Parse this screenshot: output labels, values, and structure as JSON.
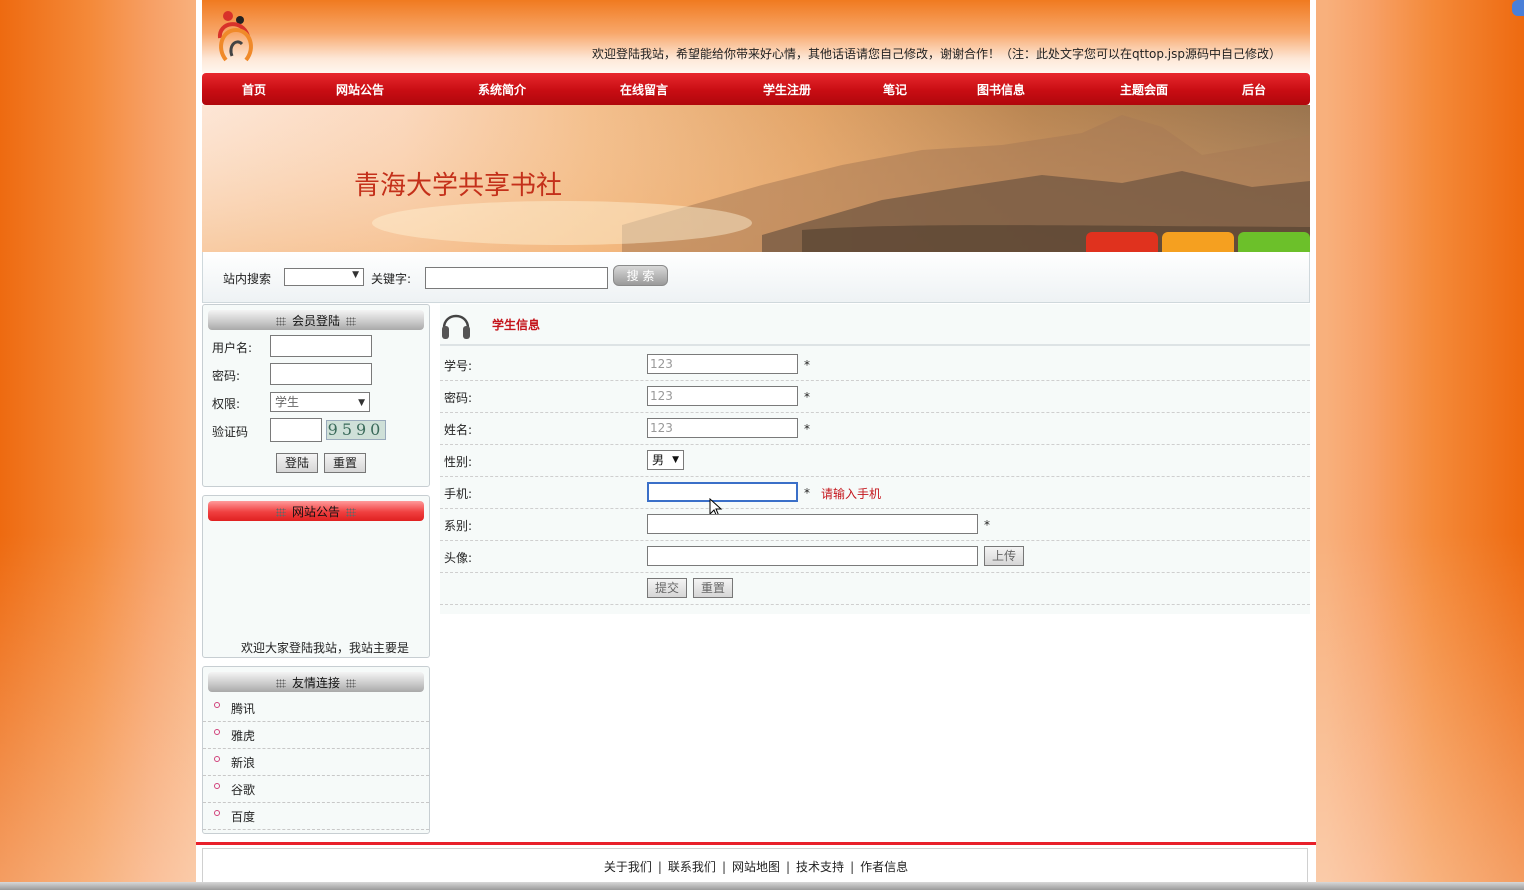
{
  "header": {
    "welcome_text": "欢迎登陆我站，希望能给你带来好心情，其他话语请您自己修改，谢谢合作！（注：此处文字您可以在qttop.jsp源码中自己修改）"
  },
  "nav": {
    "items": [
      {
        "label": "首页"
      },
      {
        "label": "网站公告"
      },
      {
        "label": "系统简介"
      },
      {
        "label": "在线留言"
      },
      {
        "label": "学生注册"
      },
      {
        "label": "笔记"
      },
      {
        "label": "图书信息"
      },
      {
        "label": "主题会面"
      },
      {
        "label": "后台"
      }
    ]
  },
  "banner": {
    "title": "青海大学共享书社"
  },
  "search": {
    "label": "站内搜索",
    "select_value": "",
    "keyword_label": "关键字:",
    "keyword_value": "",
    "button_label": "搜 索"
  },
  "login_box": {
    "title": "会员登陆",
    "username_label": "用户名:",
    "password_label": "密码:",
    "role_label": "权限:",
    "role_value": "学生",
    "captcha_label": "验证码",
    "captcha_code": "9590",
    "login_button": "登陆",
    "reset_button": "重置"
  },
  "notice_box": {
    "title": "网站公告",
    "text": "欢迎大家登陆我站，我站主要是"
  },
  "links_box": {
    "title": "友情连接",
    "items": [
      {
        "label": "腾讯"
      },
      {
        "label": "雅虎"
      },
      {
        "label": "新浪"
      },
      {
        "label": "谷歌"
      },
      {
        "label": "百度"
      }
    ]
  },
  "main": {
    "title": "学生信息",
    "fields": {
      "student_id_label": "学号:",
      "student_id_value": "123",
      "password_label": "密码:",
      "password_value": "123",
      "name_label": "姓名:",
      "name_value": "123",
      "gender_label": "性别:",
      "gender_value": "男",
      "phone_label": "手机:",
      "phone_value": "",
      "phone_error": "请输入手机",
      "department_label": "系别:",
      "department_value": "",
      "avatar_label": "头像:",
      "avatar_value": "",
      "upload_button": "上传",
      "required_mark": "*"
    },
    "submit_button": "提交",
    "reset_button": "重置"
  },
  "footer": {
    "links": [
      {
        "label": "关于我们"
      },
      {
        "label": "联系我们"
      },
      {
        "label": "网站地图"
      },
      {
        "label": "技术支持"
      },
      {
        "label": "作者信息"
      }
    ]
  },
  "colors": {
    "accent_red": "#c80d13",
    "error_red": "#c4151c",
    "background_orange": "#f07a20"
  }
}
